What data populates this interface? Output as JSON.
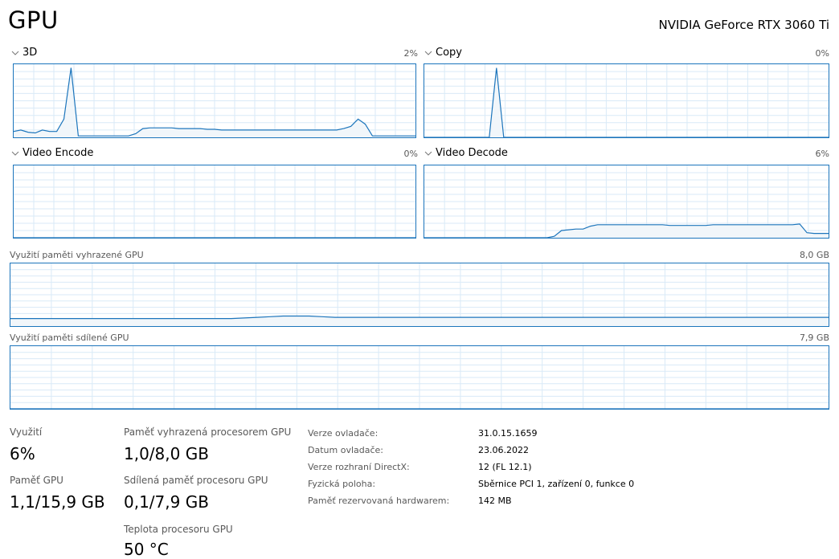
{
  "header": {
    "title": "GPU",
    "device": "NVIDIA GeForce RTX 3060 Ti"
  },
  "engines": [
    {
      "name": "3D",
      "percent": "2%",
      "points": [
        0.08,
        0.1,
        0.07,
        0.06,
        0.1,
        0.08,
        0.08,
        0.25,
        0.95,
        0.02,
        0.02,
        0.02,
        0.02,
        0.02,
        0.02,
        0.02,
        0.02,
        0.05,
        0.12,
        0.13,
        0.13,
        0.13,
        0.13,
        0.12,
        0.12,
        0.12,
        0.12,
        0.11,
        0.11,
        0.1,
        0.1,
        0.1,
        0.1,
        0.1,
        0.1,
        0.1,
        0.1,
        0.1,
        0.1,
        0.1,
        0.1,
        0.1,
        0.1,
        0.1,
        0.1,
        0.1,
        0.12,
        0.15,
        0.25,
        0.18,
        0.02,
        0.02,
        0.02,
        0.02,
        0.02,
        0.02,
        0.02
      ]
    },
    {
      "name": "Copy",
      "percent": "0%",
      "points": [
        0,
        0,
        0,
        0,
        0,
        0,
        0,
        0,
        0,
        0,
        0.95,
        0,
        0,
        0,
        0,
        0,
        0,
        0,
        0,
        0,
        0,
        0,
        0,
        0,
        0,
        0,
        0,
        0,
        0,
        0,
        0,
        0,
        0,
        0,
        0,
        0,
        0,
        0,
        0,
        0,
        0,
        0,
        0,
        0,
        0,
        0,
        0,
        0,
        0,
        0,
        0,
        0,
        0,
        0,
        0,
        0,
        0
      ]
    },
    {
      "name": "Video Encode",
      "percent": "0%",
      "points": [
        0,
        0,
        0,
        0,
        0,
        0,
        0,
        0,
        0,
        0,
        0,
        0,
        0,
        0,
        0,
        0,
        0,
        0,
        0,
        0,
        0,
        0,
        0,
        0,
        0,
        0,
        0,
        0,
        0,
        0,
        0,
        0,
        0,
        0,
        0,
        0,
        0,
        0,
        0,
        0,
        0,
        0,
        0,
        0,
        0,
        0,
        0,
        0,
        0,
        0,
        0,
        0,
        0,
        0,
        0,
        0,
        0
      ]
    },
    {
      "name": "Video Decode",
      "percent": "6%",
      "points": [
        0,
        0,
        0,
        0,
        0,
        0,
        0,
        0,
        0,
        0,
        0,
        0,
        0,
        0,
        0,
        0,
        0,
        0,
        0.02,
        0.1,
        0.11,
        0.12,
        0.12,
        0.16,
        0.18,
        0.18,
        0.18,
        0.18,
        0.18,
        0.18,
        0.18,
        0.18,
        0.18,
        0.18,
        0.17,
        0.17,
        0.17,
        0.17,
        0.17,
        0.17,
        0.18,
        0.18,
        0.18,
        0.18,
        0.18,
        0.18,
        0.18,
        0.18,
        0.18,
        0.18,
        0.18,
        0.18,
        0.19,
        0.07,
        0.06,
        0.06,
        0.06
      ]
    }
  ],
  "memory": [
    {
      "caption": "Využití paměti vyhrazené GPU",
      "max": "8,0 GB",
      "points": [
        0.12,
        0.12,
        0.12,
        0.12,
        0.12,
        0.12,
        0.12,
        0.12,
        0.12,
        0.12,
        0.12,
        0.12,
        0.12,
        0.12,
        0.12,
        0.12,
        0.12,
        0.12,
        0.13,
        0.14,
        0.15,
        0.16,
        0.16,
        0.16,
        0.15,
        0.14,
        0.14,
        0.14,
        0.14,
        0.14,
        0.14,
        0.14,
        0.14,
        0.14,
        0.14,
        0.14,
        0.14,
        0.14,
        0.14,
        0.14,
        0.14,
        0.14,
        0.14,
        0.14,
        0.14,
        0.14,
        0.14,
        0.14,
        0.14,
        0.14,
        0.14,
        0.14,
        0.14,
        0.14,
        0.14,
        0.14,
        0.14,
        0.14,
        0.14,
        0.14,
        0.14,
        0.14,
        0.14,
        0.14
      ]
    },
    {
      "caption": "Využití paměti sdílené GPU",
      "max": "7,9 GB",
      "points": [
        0,
        0,
        0,
        0,
        0,
        0,
        0,
        0,
        0,
        0,
        0,
        0,
        0,
        0,
        0,
        0,
        0,
        0,
        0,
        0,
        0,
        0,
        0,
        0,
        0,
        0,
        0,
        0,
        0,
        0,
        0,
        0,
        0,
        0,
        0,
        0,
        0,
        0,
        0,
        0,
        0,
        0,
        0,
        0,
        0,
        0,
        0,
        0,
        0,
        0,
        0,
        0,
        0,
        0,
        0,
        0,
        0,
        0,
        0,
        0,
        0,
        0,
        0,
        0
      ]
    }
  ],
  "stats": {
    "utilization": {
      "label": "Využití",
      "value": "6%"
    },
    "gpu_memory": {
      "label": "Paměť GPU",
      "value": "1,1/15,9 GB"
    },
    "dedicated": {
      "label": "Paměť vyhrazená procesorem GPU",
      "value": "1,0/8,0 GB"
    },
    "shared": {
      "label": "Sdílená paměť procesoru GPU",
      "value": "0,1/7,9 GB"
    },
    "temperature": {
      "label": "Teplota procesoru GPU",
      "value": "50 °C"
    }
  },
  "info": [
    {
      "label": "Verze ovladače:",
      "value": "31.0.15.1659"
    },
    {
      "label": "Datum ovladače:",
      "value": "23.06.2022"
    },
    {
      "label": "Verze rozhraní DirectX:",
      "value": "12 (FL 12.1)"
    },
    {
      "label": "Fyzická poloha:",
      "value": "Sběrnice PCI 1, zařízení 0, funkce 0"
    },
    {
      "label": "Paměť rezervovaná hardwarem:",
      "value": "142 MB"
    }
  ],
  "colors": {
    "accent": "#1c75bc",
    "grid": "#d9eaf7",
    "fill": "#f1f6fa"
  },
  "icons": {
    "engine_dropdown": "chevron-down-icon"
  }
}
